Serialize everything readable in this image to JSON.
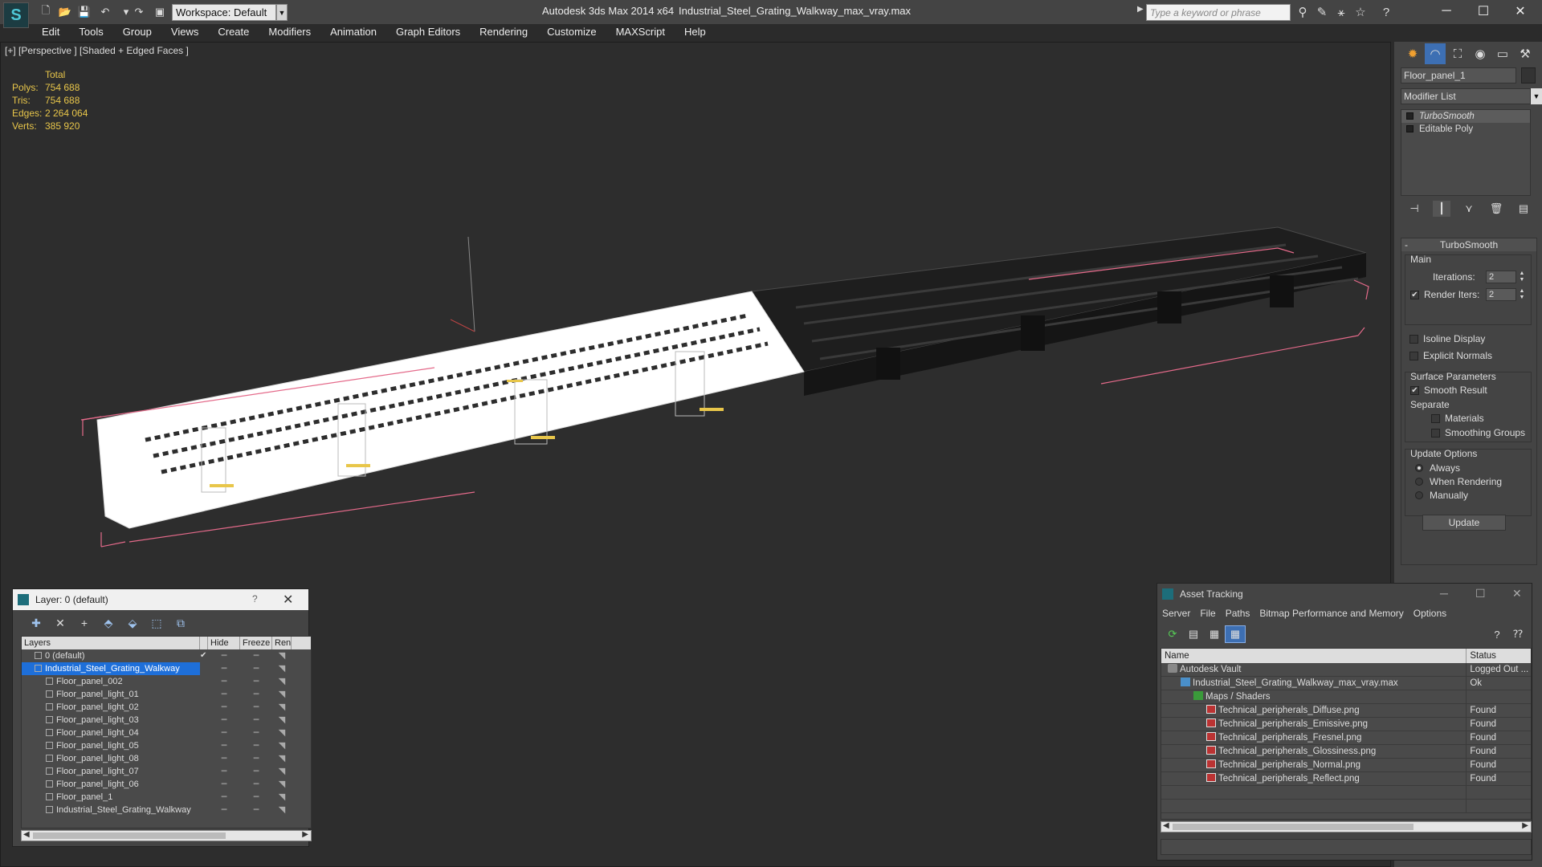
{
  "titlebar": {
    "workspace": "Workspace: Default",
    "app_title": "Autodesk 3ds Max  2014 x64",
    "file_title": "Industrial_Steel_Grating_Walkway_max_vray.max",
    "search_placeholder": "Type a keyword or phrase"
  },
  "menu": [
    "Edit",
    "Tools",
    "Group",
    "Views",
    "Create",
    "Modifiers",
    "Animation",
    "Graph Editors",
    "Rendering",
    "Customize",
    "MAXScript",
    "Help"
  ],
  "viewport": {
    "label": "[+] [Perspective ] [Shaded + Edged Faces ]",
    "stats": {
      "header": "Total",
      "rows": [
        {
          "label": "Polys:",
          "value": "754 688"
        },
        {
          "label": "Tris:",
          "value": "754 688"
        },
        {
          "label": "Edges:",
          "value": "2 264 064"
        },
        {
          "label": "Verts:",
          "value": "385 920"
        }
      ]
    },
    "colors": {
      "background": "#2d2d2d",
      "selected": "#ffffff",
      "unselected": "#1a1a1a",
      "bbox": "#e46a8a",
      "highlight": "#e8c64a"
    }
  },
  "command_panel": {
    "object_name": "Floor_panel_1",
    "modifier_list": "Modifier List",
    "stack": [
      {
        "label": "TurboSmooth",
        "selected": true
      },
      {
        "label": "Editable Poly",
        "selected": false
      }
    ],
    "turbosmooth": {
      "title": "TurboSmooth",
      "main_title": "Main",
      "iterations_label": "Iterations:",
      "iterations_value": "2",
      "render_iters_label": "Render Iters:",
      "render_iters_value": "2",
      "isoline_label": "Isoline Display",
      "explicit_normals_label": "Explicit Normals",
      "surface_title": "Surface Parameters",
      "smooth_result_label": "Smooth Result",
      "separate_label": "Separate",
      "materials_label": "Materials",
      "smoothing_groups_label": "Smoothing Groups",
      "update_title": "Update Options",
      "always_label": "Always",
      "when_rendering_label": "When Rendering",
      "manually_label": "Manually",
      "update_button": "Update"
    }
  },
  "layer_dialog": {
    "title": "Layer: 0 (default)",
    "help": "?",
    "columns": {
      "layers": "Layers",
      "hide": "Hide",
      "freeze": "Freeze",
      "render": "Ren"
    },
    "rows": [
      {
        "name": "0 (default)",
        "indent": 1,
        "active": "✔",
        "selected": false
      },
      {
        "name": "Industrial_Steel_Grating_Walkway",
        "indent": 1,
        "active": "",
        "selected": true
      },
      {
        "name": "Floor_panel_002",
        "indent": 2,
        "active": "",
        "selected": false
      },
      {
        "name": "Floor_panel_light_01",
        "indent": 2,
        "active": "",
        "selected": false
      },
      {
        "name": "Floor_panel_light_02",
        "indent": 2,
        "active": "",
        "selected": false
      },
      {
        "name": "Floor_panel_light_03",
        "indent": 2,
        "active": "",
        "selected": false
      },
      {
        "name": "Floor_panel_light_04",
        "indent": 2,
        "active": "",
        "selected": false
      },
      {
        "name": "Floor_panel_light_05",
        "indent": 2,
        "active": "",
        "selected": false
      },
      {
        "name": "Floor_panel_light_08",
        "indent": 2,
        "active": "",
        "selected": false
      },
      {
        "name": "Floor_panel_light_07",
        "indent": 2,
        "active": "",
        "selected": false
      },
      {
        "name": "Floor_panel_light_06",
        "indent": 2,
        "active": "",
        "selected": false
      },
      {
        "name": "Floor_panel_1",
        "indent": 2,
        "active": "",
        "selected": false
      },
      {
        "name": "Industrial_Steel_Grating_Walkway",
        "indent": 2,
        "active": "",
        "selected": false
      }
    ]
  },
  "asset_dialog": {
    "title": "Asset Tracking",
    "menu": [
      "Server",
      "File",
      "Paths",
      "Bitmap Performance and Memory",
      "Options"
    ],
    "columns": {
      "name": "Name",
      "status": "Status"
    },
    "rows": [
      {
        "name": "Autodesk Vault",
        "status": "Logged Out ...",
        "indent": 1,
        "icon": "vault"
      },
      {
        "name": "Industrial_Steel_Grating_Walkway_max_vray.max",
        "status": "Ok",
        "indent": 2,
        "icon": "max"
      },
      {
        "name": "Maps / Shaders",
        "status": "",
        "indent": 3,
        "icon": "maps"
      },
      {
        "name": "Technical_peripherals_Diffuse.png",
        "status": "Found",
        "indent": 4,
        "icon": "png"
      },
      {
        "name": "Technical_peripherals_Emissive.png",
        "status": "Found",
        "indent": 4,
        "icon": "png"
      },
      {
        "name": "Technical_peripherals_Fresnel.png",
        "status": "Found",
        "indent": 4,
        "icon": "png"
      },
      {
        "name": "Technical_peripherals_Glossiness.png",
        "status": "Found",
        "indent": 4,
        "icon": "png"
      },
      {
        "name": "Technical_peripherals_Normal.png",
        "status": "Found",
        "indent": 4,
        "icon": "png"
      },
      {
        "name": "Technical_peripherals_Reflect.png",
        "status": "Found",
        "indent": 4,
        "icon": "png"
      }
    ]
  }
}
